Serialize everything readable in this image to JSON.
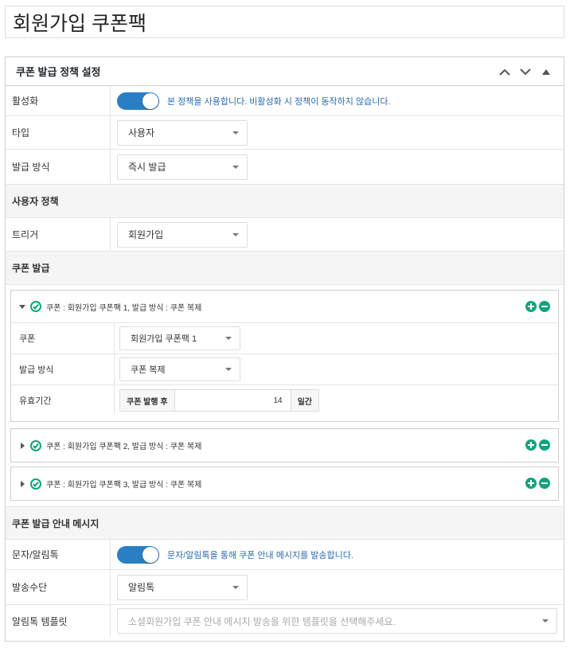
{
  "page_title": "회원가입 쿠폰팩",
  "panel": {
    "title": "쿠폰 발급 정책 설정",
    "fields": {
      "active_label": "활성화",
      "active_hint": "본 정책을 사용합니다. 비활성화 시 정책이 동작하지 않습니다.",
      "type_label": "타입",
      "type_value": "사용자",
      "issue_method_label": "발급 방식",
      "issue_method_value": "즉시 발급"
    },
    "user_policy": {
      "section_title": "사용자 정책",
      "trigger_label": "트리거",
      "trigger_value": "회원가입"
    },
    "coupon_issue": {
      "section_title": "쿠폰 발급",
      "items": [
        {
          "title": "쿠폰 : 회원가입 쿠폰팩 1, 발급 방식 : 쿠폰 복제",
          "coupon_label": "쿠폰",
          "coupon_value": "회원가입 쿠폰팩 1",
          "method_label": "발급 방식",
          "method_value": "쿠폰 복제",
          "validity_label": "유효기간",
          "validity_prefix": "쿠폰 발행 후",
          "validity_value": "14",
          "validity_suffix": "일간"
        },
        {
          "title": "쿠폰 : 회원가입 쿠폰팩 2, 발급 방식 : 쿠폰 복제"
        },
        {
          "title": "쿠폰 : 회원가입 쿠폰팩 3, 발급 방식 : 쿠폰 복제"
        }
      ]
    },
    "message": {
      "section_title": "쿠폰 발급 안내 메시지",
      "sms_label": "문자/알림톡",
      "sms_hint": "문자/알림톡을 통해 쿠폰 안내 메시지를 발송합니다.",
      "channel_label": "발송수단",
      "channel_value": "알림톡",
      "template_label": "알림톡 템플릿",
      "template_placeholder": "소셜회원가입 쿠폰 안내 메시지 발송을 위한 템플릿을 선택해주세요."
    }
  },
  "colors": {
    "accent": "#2a7fc4",
    "success": "#10a37f",
    "hint": "#2a6bb0"
  },
  "icons": [
    "chevron-up-icon",
    "chevron-down-icon",
    "triangle-up-icon",
    "check-circle-icon",
    "plus-circle-icon",
    "minus-circle-icon",
    "caret-down-icon",
    "caret-right-icon"
  ]
}
